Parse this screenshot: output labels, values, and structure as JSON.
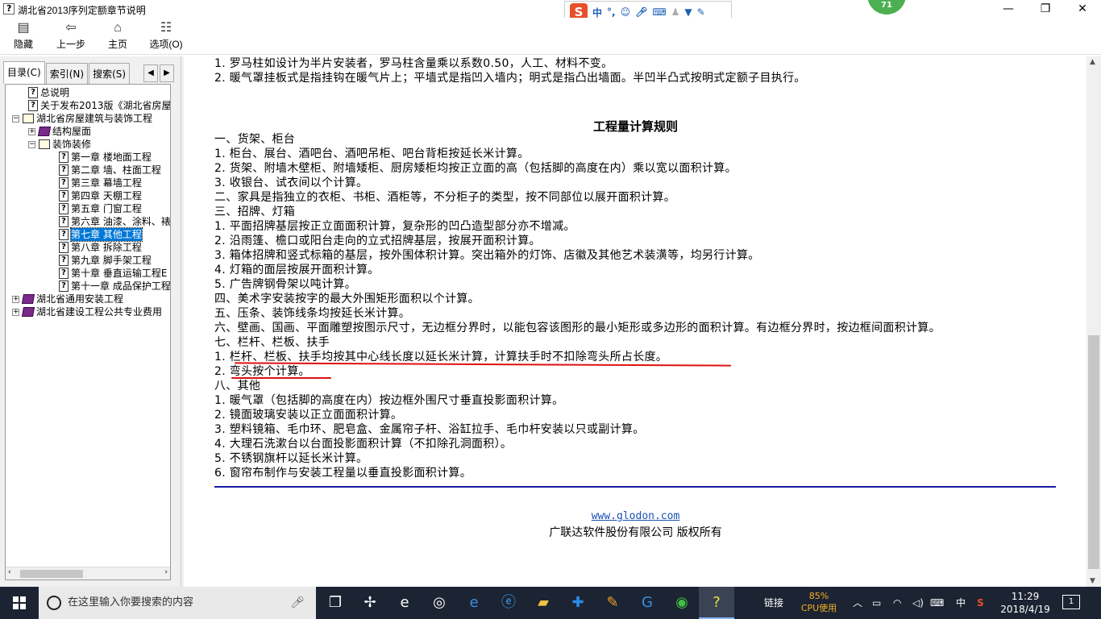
{
  "window": {
    "title": "湖北省2013序列定额章节说明",
    "min_glyph": "—",
    "max_glyph": "❐",
    "close_glyph": "✕"
  },
  "ime": {
    "lang": "中",
    "punct": "°,",
    "icons": [
      "smile-icon",
      "mic-icon",
      "keyboard-icon",
      "user-icon",
      "shirt-icon",
      "wrench-icon"
    ]
  },
  "badge": "71",
  "toolbar": {
    "hide": "隐藏",
    "back": "上一步",
    "home": "主页",
    "options": "选项(O)"
  },
  "tabs": {
    "contents": "目录(C)",
    "index": "索引(N)",
    "search": "搜索(S)"
  },
  "tree": [
    {
      "label": "总说明",
      "kind": "page",
      "level": 1
    },
    {
      "label": "关于发布2013版《湖北省房屋",
      "kind": "page",
      "level": 1
    },
    {
      "label": "湖北省房屋建筑与装饰工程",
      "kind": "book-open",
      "level": 0,
      "expander": "−"
    },
    {
      "label": "结构屋面",
      "kind": "book-closed",
      "level": 1,
      "expander": "+"
    },
    {
      "label": "装饰装修",
      "kind": "book-open",
      "level": 1,
      "expander": "−"
    },
    {
      "label": "第一章  楼地面工程",
      "kind": "page",
      "level": 2
    },
    {
      "label": "第二章  墙、柱面工程",
      "kind": "page",
      "level": 2
    },
    {
      "label": "第三章  幕墙工程",
      "kind": "page",
      "level": 2
    },
    {
      "label": "第四章  天棚工程",
      "kind": "page",
      "level": 2
    },
    {
      "label": "第五章  门窗工程",
      "kind": "page",
      "level": 2
    },
    {
      "label": "第六章  油漆、涂料、裱",
      "kind": "page",
      "level": 2
    },
    {
      "label": "第七章  其他工程",
      "kind": "page",
      "level": 2,
      "selected": true
    },
    {
      "label": "第八章  拆除工程",
      "kind": "page",
      "level": 2
    },
    {
      "label": "第九章  脚手架工程",
      "kind": "page",
      "level": 2
    },
    {
      "label": "第十章  垂直运输工程E",
      "kind": "page",
      "level": 2
    },
    {
      "label": "第十一章  成品保护工程",
      "kind": "page",
      "level": 2
    },
    {
      "label": "湖北省通用安装工程",
      "kind": "book-closed",
      "level": 0,
      "expander": "+"
    },
    {
      "label": "湖北省建设工程公共专业费用",
      "kind": "book-closed",
      "level": 0,
      "expander": "+"
    }
  ],
  "content": {
    "lines": [
      "1. 罗马柱如设计为半片安装者，罗马柱含量乘以系数0.50，人工、材料不变。",
      "2. 暖气罩挂板式是指挂钩在暖气片上；平墙式是指凹入墙内；明式是指凸出墙面。半凹半凸式按明式定额子目执行。"
    ],
    "heading": "工程量计算规则",
    "rules": [
      "一、货架、柜台",
      "1. 柜台、展台、酒吧台、酒吧吊柜、吧台背柜按延长米计算。",
      "2. 货架、附墙木壁柜、附墙矮柜、厨房矮柜均按正立面的高（包括脚的高度在内）乘以宽以面积计算。",
      "3. 收银台、试衣间以个计算。",
      "二、家具是指独立的衣柜、书柜、酒柜等，不分柜子的类型，按不同部位以展开面积计算。",
      "三、招牌、灯箱",
      "1. 平面招牌基层按正立面面积计算，复杂形的凹凸造型部分亦不增减。",
      "2. 沿雨篷、檐口或阳台走向的立式招牌基层，按展开面积计算。",
      "3. 箱体招牌和竖式标箱的基层，按外围体积计算。突出箱外的灯饰、店徽及其他艺术装潢等，均另行计算。",
      "4. 灯箱的面层按展开面积计算。",
      "5. 广告牌钢骨架以吨计算。",
      "四、美术字安装按字的最大外围矩形面积以个计算。",
      "五、压条、装饰线条均按延长米计算。",
      "六、壁画、国画、平面雕塑按图示尺寸，无边框分界时，以能包容该图形的最小矩形或多边形的面积计算。有边框分界时，按边框间面积计算。",
      "七、栏杆、栏板、扶手",
      "1. 栏杆、栏板、扶手均按其中心线长度以延长米计算，计算扶手时不扣除弯头所占长度。",
      "2. 弯头按个计算。",
      "八、其他",
      "1. 暖气罩（包括脚的高度在内）按边框外围尺寸垂直投影面积计算。",
      "2. 镜面玻璃安装以正立面面积计算。",
      "3. 塑料镜箱、毛巾环、肥皂盒、金属帘子杆、浴缸拉手、毛巾杆安装以只或副计算。",
      "4. 大理石洗漱台以台面投影面积计算（不扣除孔洞面积）。",
      "5. 不锈钢旗杆以延长米计算。",
      "6. 窗帘布制作与安装工程量以垂直投影面积计算。"
    ],
    "footer_link": "www.glodon.com",
    "copyright": "广联达软件股份有限公司  版权所有"
  },
  "taskbar": {
    "search_placeholder": "在这里输入你要搜索的内容",
    "links_label": "链接",
    "cpu_percent": "85%",
    "cpu_label": "CPU使用",
    "ime_lang": "中",
    "time": "11:29",
    "date": "2018/4/19",
    "notif_count": "1",
    "apps": [
      "task-view-icon",
      "fan-icon",
      "edge-legacy-icon",
      "chrome-icon",
      "edge-icon",
      "ie-icon",
      "folder-icon",
      "glodon-icon",
      "notepad-icon",
      "g-app-icon",
      "360-icon",
      "help-app-icon"
    ]
  },
  "colors": {
    "accent": "#0078d7",
    "annotation_red": "#e01010",
    "rule_blue": "#1a1aa8"
  }
}
